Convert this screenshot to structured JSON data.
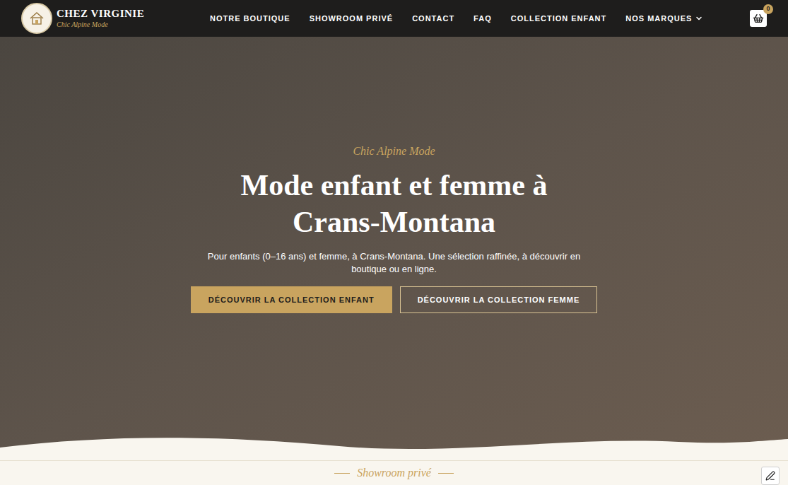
{
  "brand": {
    "name": "CHEZ VIRGINIE",
    "tagline": "Chic Alpine Mode"
  },
  "nav": [
    {
      "label": "NOTRE BOUTIQUE",
      "dropdown": false
    },
    {
      "label": "SHOWROOM PRIVÉ",
      "dropdown": false
    },
    {
      "label": "CONTACT",
      "dropdown": false
    },
    {
      "label": "FAQ",
      "dropdown": false
    },
    {
      "label": "COLLECTION ENFANT",
      "dropdown": false
    },
    {
      "label": "NOS MARQUES",
      "dropdown": true
    }
  ],
  "cart": {
    "count": "0"
  },
  "hero": {
    "eyebrow": "Chic Alpine Mode",
    "title": "Mode enfant et femme à Crans-Montana",
    "text": "Pour enfants (0–16 ans) et femme, à Crans-Montana. Une sélection raffinée, à découvrir en boutique ou en ligne.",
    "buttons": [
      {
        "label": "DÉCOUVRIR LA COLLECTION ENFANT",
        "kind": "filled"
      },
      {
        "label": "DÉCOUVRIR LA COLLECTION FEMME",
        "kind": "outline"
      }
    ]
  },
  "next_section": {
    "label": "Showroom privé"
  }
}
